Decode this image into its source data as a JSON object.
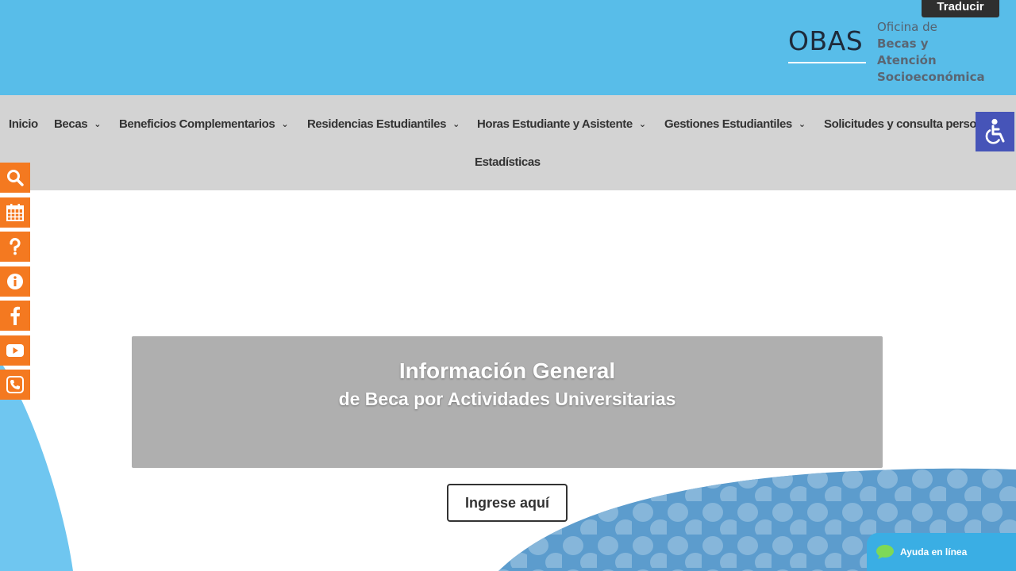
{
  "header": {
    "translate_label": "Traducir",
    "logo_mark": "OBAS",
    "logo_line1": "Oficina de",
    "logo_line2": "Becas y Atención",
    "logo_line3": "Socioeconómica"
  },
  "nav": {
    "items": [
      {
        "label": "Inicio",
        "has_dropdown": false
      },
      {
        "label": "Becas",
        "has_dropdown": true
      },
      {
        "label": "Beneficios Complementarios",
        "has_dropdown": true
      },
      {
        "label": "Residencias Estudiantiles",
        "has_dropdown": true
      },
      {
        "label": "Horas Estudiante y Asistente",
        "has_dropdown": true
      },
      {
        "label": "Gestiones Estudiantiles",
        "has_dropdown": true
      },
      {
        "label": "Solicitudes y consulta perso",
        "has_dropdown": false
      }
    ],
    "second_row_label": "Estadísticas"
  },
  "side_bar": {
    "icons": [
      "search-icon",
      "calendar-icon",
      "question-icon",
      "info-icon",
      "facebook-icon",
      "youtube-icon",
      "phone-icon"
    ]
  },
  "hero": {
    "title": "Información General",
    "subtitle": "de Beca por Actividades Universitarias",
    "cta_label": "Ingrese aquí"
  },
  "chat": {
    "label": "Ayuda en línea"
  },
  "colors": {
    "header_bg": "#58bde9",
    "nav_bg": "#d3d3d3",
    "side_accent": "#f47920",
    "a11y_bg": "#4654b8",
    "hero_bg": "#afafaf"
  }
}
